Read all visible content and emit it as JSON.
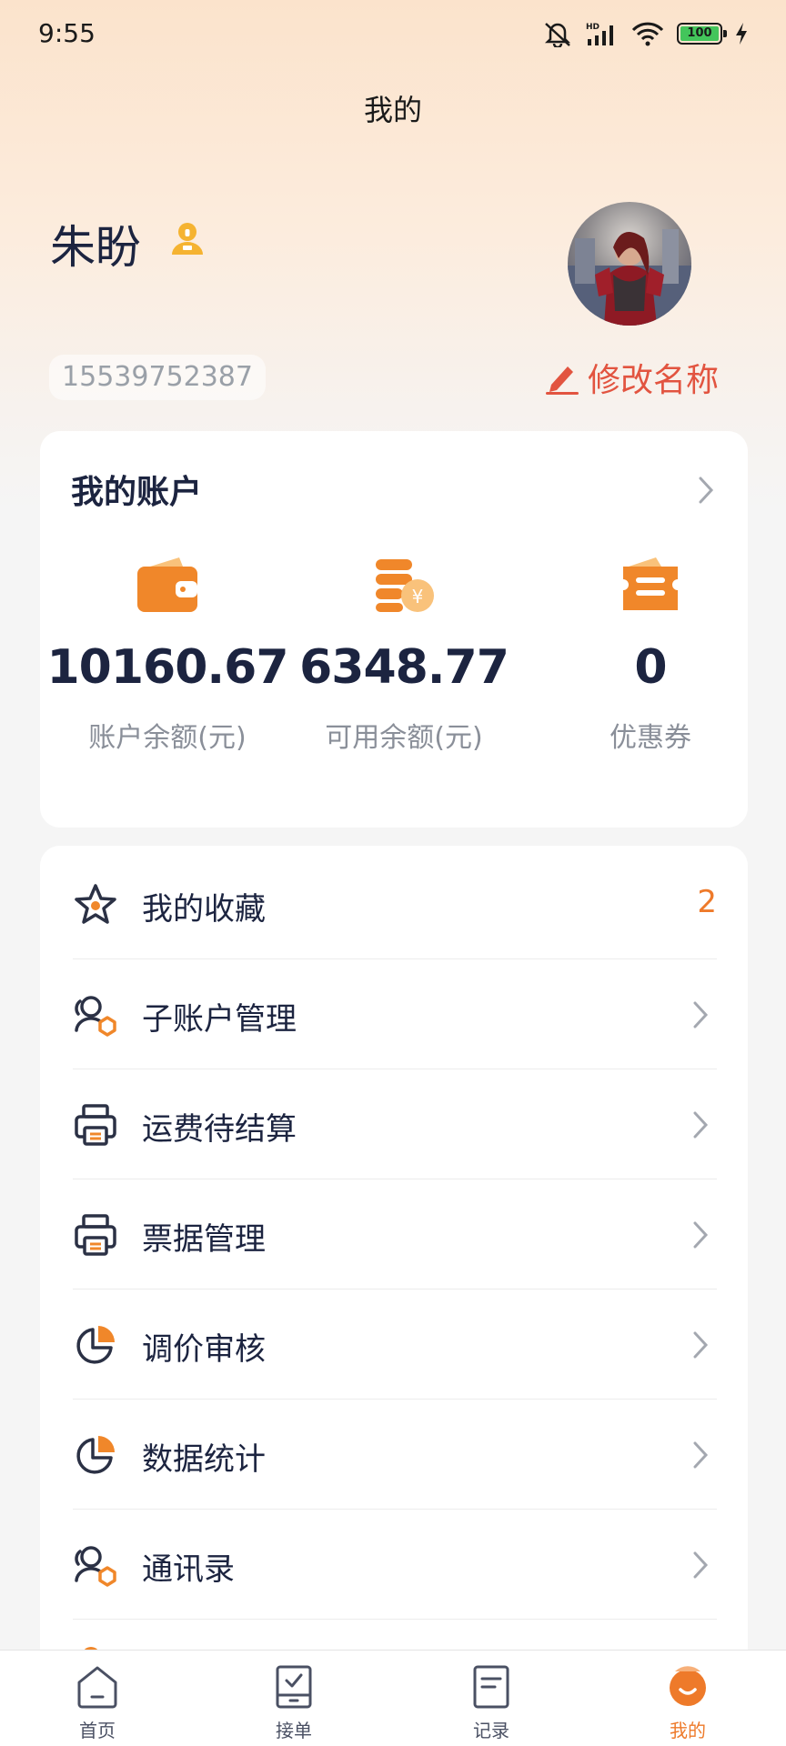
{
  "status_bar": {
    "time": "9:55",
    "battery": "100"
  },
  "header": {
    "title": "我的"
  },
  "profile": {
    "name": "朱盼",
    "phone": "15539752387",
    "edit_label": "修改名称"
  },
  "account": {
    "title": "我的账户",
    "stats": [
      {
        "value": "10160.67",
        "label": "账户余额(元)",
        "icon": "wallet-icon"
      },
      {
        "value": "6348.77",
        "label": "可用余额(元)",
        "icon": "coins-icon"
      },
      {
        "value": "0",
        "label": "优惠券",
        "icon": "coupon-icon"
      }
    ]
  },
  "menu": {
    "items": [
      {
        "label": "我的收藏",
        "icon": "star-icon",
        "badge": "2"
      },
      {
        "label": "子账户管理",
        "icon": "sub-account-icon"
      },
      {
        "label": "运费待结算",
        "icon": "printer-icon"
      },
      {
        "label": "票据管理",
        "icon": "printer-icon"
      },
      {
        "label": "调价审核",
        "icon": "pie-chart-icon"
      },
      {
        "label": "数据统计",
        "icon": "pie-chart-icon"
      },
      {
        "label": "通讯录",
        "icon": "contacts-icon"
      }
    ]
  },
  "bottom_nav": {
    "tabs": [
      {
        "label": "首页",
        "icon": "home-icon"
      },
      {
        "label": "接单",
        "icon": "accept-order-icon"
      },
      {
        "label": "记录",
        "icon": "records-icon"
      },
      {
        "label": "我的",
        "icon": "profile-icon",
        "active": true
      }
    ]
  },
  "colors": {
    "accent": "#ee7a2a",
    "edit": "#e25440",
    "text_dark": "#1c2440"
  }
}
